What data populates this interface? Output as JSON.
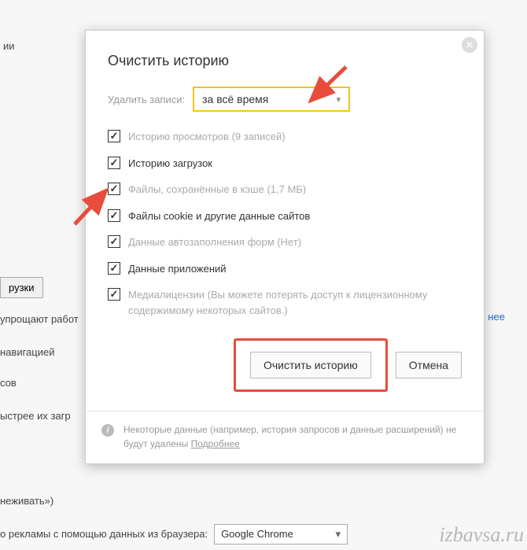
{
  "background": {
    "top_fragment": "ии",
    "btn_downloads": "рузки",
    "line_simplify": "упрощают работ",
    "line_nav": "навигацией",
    "line_sov": "сов",
    "line_faster": "ыстрее их загр",
    "line_track": "неживать»)",
    "line_ads_prefix": "о рекламы с помощью данных из браузера:",
    "ads_select": "Google Chrome",
    "link_more": "нее"
  },
  "dialog": {
    "title": "Очистить историю",
    "range_label": "Удалить записи:",
    "range_value": "за всё время",
    "items": [
      {
        "checked": true,
        "label": "Историю просмотров",
        "suffix": "(9 записей)",
        "muted_all": true
      },
      {
        "checked": true,
        "label": "Историю загрузок",
        "suffix": "",
        "muted_all": false
      },
      {
        "checked": true,
        "label": "Файлы, сохранённые в кэше",
        "suffix": "(1,7 МБ)",
        "muted_all": true
      },
      {
        "checked": true,
        "label": "Файлы cookie и другие данные сайтов",
        "suffix": "",
        "muted_all": false
      },
      {
        "checked": true,
        "label": "Данные автозаполнения форм",
        "suffix": "(Нет)",
        "muted_all": true
      },
      {
        "checked": true,
        "label": "Данные приложений",
        "suffix": "",
        "muted_all": false
      },
      {
        "checked": true,
        "label": "Медиалицензии",
        "suffix": "(Вы можете потерять доступ к лицензионному содержимому некоторых сайтов.)",
        "muted_all": true
      }
    ],
    "btn_clear": "Очистить историю",
    "btn_cancel": "Отмена",
    "footer_text": "Некоторые данные (например, история запросов и данные расширений) не будут удалены ",
    "footer_link": "Подробнее"
  },
  "watermark": "izbavsa.ru"
}
